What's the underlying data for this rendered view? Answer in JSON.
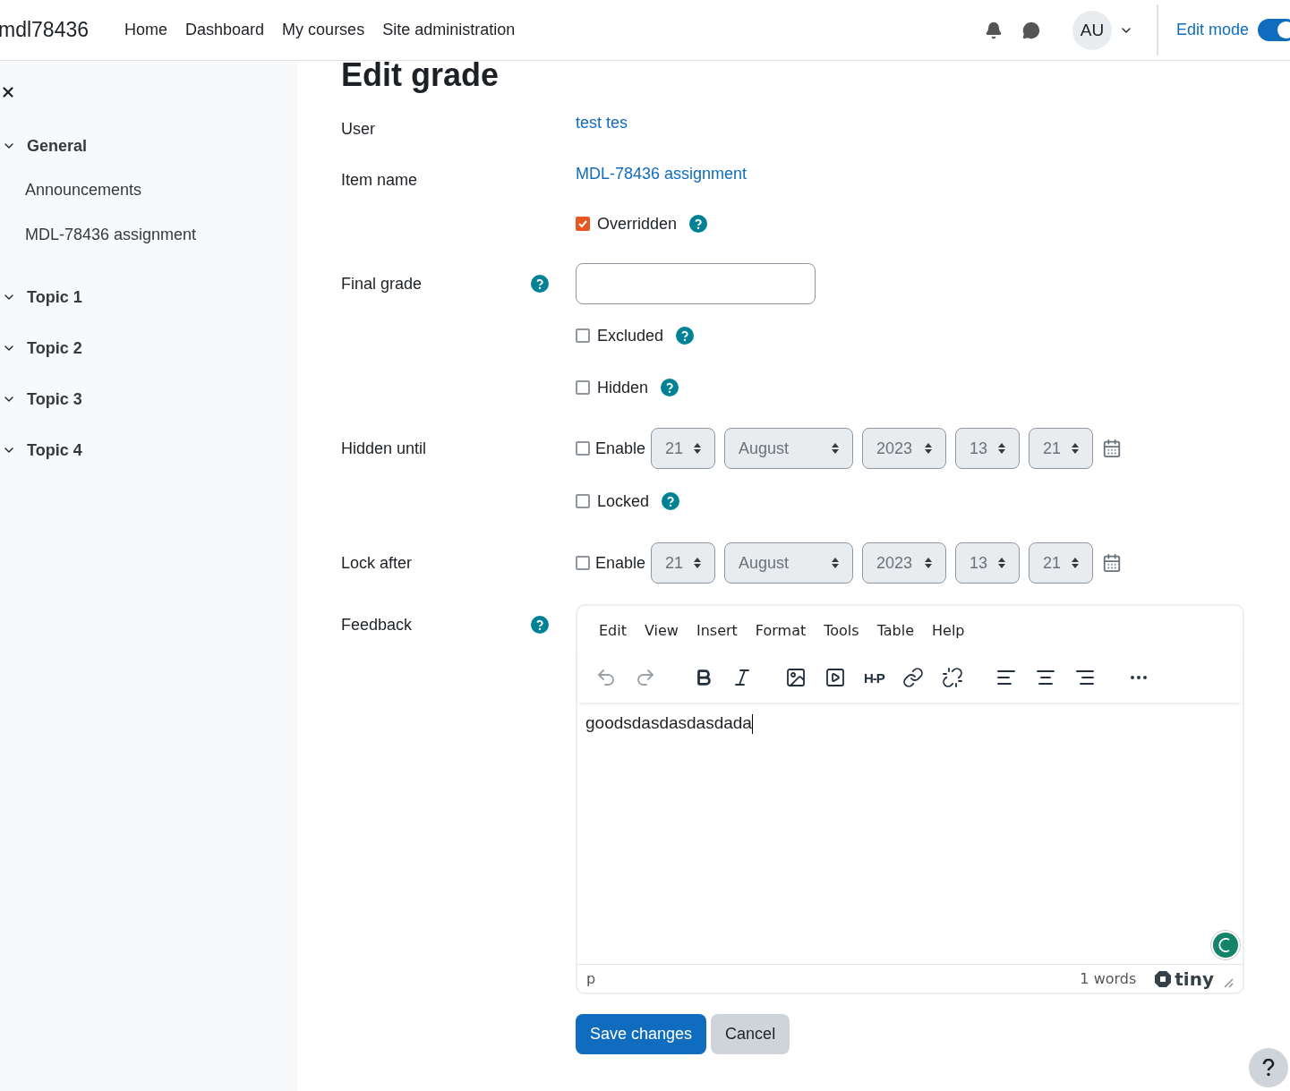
{
  "header": {
    "brand": "mdl78436",
    "nav": [
      "Home",
      "Dashboard",
      "My courses",
      "Site administration"
    ],
    "avatar": "AU",
    "edit_mode": {
      "label": "Edit mode",
      "on": true
    }
  },
  "sidebar": {
    "sections": [
      {
        "title": "General",
        "expanded": true,
        "children": [
          {
            "label": "Announcements"
          },
          {
            "label": "MDL-78436 assignment"
          }
        ]
      },
      {
        "title": "Topic 1",
        "expanded": true
      },
      {
        "title": "Topic 2",
        "expanded": true
      },
      {
        "title": "Topic 3",
        "expanded": true
      },
      {
        "title": "Topic 4",
        "expanded": true
      }
    ]
  },
  "page_title": "Edit grade",
  "form": [
    {
      "kind": "link",
      "label": "User",
      "value": "test tes"
    },
    {
      "kind": "link",
      "label": "Item name",
      "value": "MDL-78436 assignment"
    },
    {
      "kind": "checkbox",
      "text": "Overridden",
      "checked": true,
      "help": true
    },
    {
      "kind": "input",
      "label": "Final grade",
      "help": true
    },
    {
      "kind": "checkbox",
      "text": "Excluded",
      "checked": false,
      "help": true
    },
    {
      "kind": "checkbox",
      "text": "Hidden",
      "checked": false,
      "help": true
    },
    {
      "kind": "date",
      "label": "Hidden until",
      "text": "Enable",
      "checked": false,
      "selects": [
        "21",
        "August",
        "2023",
        "13",
        "21"
      ]
    },
    {
      "kind": "checkbox",
      "text": "Locked",
      "checked": false,
      "help": true
    },
    {
      "kind": "date",
      "label": "Lock after",
      "text": "Enable",
      "checked": false,
      "selects": [
        "21",
        "August",
        "2023",
        "13",
        "21"
      ]
    },
    {
      "kind": "editor",
      "label": "Feedback",
      "help": true
    }
  ],
  "editor": {
    "menu": [
      "Edit",
      "View",
      "Insert",
      "Format",
      "Tools",
      "Table",
      "Help"
    ],
    "toolbar": [
      {
        "kind": "undo",
        "disabled": true
      },
      {
        "kind": "redo",
        "disabled": true
      },
      {
        "kind": "bold",
        "disabled": false
      },
      {
        "kind": "italic",
        "disabled": false
      },
      {
        "kind": "image",
        "disabled": false
      },
      {
        "kind": "media",
        "disabled": false
      },
      {
        "kind": "h5p",
        "label": "H-P",
        "disabled": false
      },
      {
        "kind": "link",
        "disabled": false
      },
      {
        "kind": "unlink",
        "disabled": false
      },
      {
        "kind": "align-left",
        "disabled": false
      },
      {
        "kind": "align-center",
        "disabled": false
      },
      {
        "kind": "align-right",
        "disabled": false
      },
      {
        "kind": "more",
        "disabled": false
      }
    ],
    "content": "goodsdasdasdasdada",
    "path": "p",
    "word_count": "1 words",
    "brand": "tiny"
  },
  "buttons": [
    {
      "label": "Save changes",
      "kind": "primary"
    },
    {
      "label": "Cancel",
      "kind": "secondary"
    }
  ]
}
